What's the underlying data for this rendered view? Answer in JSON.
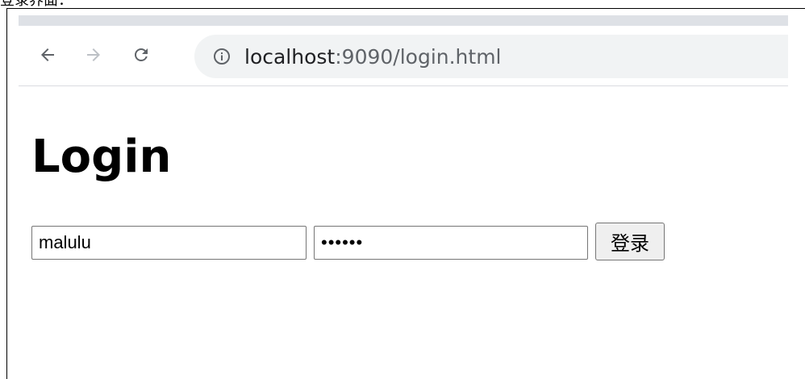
{
  "caption": "登录界面：",
  "browser": {
    "address_bar": {
      "host": "localhost",
      "rest": ":9090/login.html"
    },
    "icons": {
      "back": "arrow-left-icon",
      "forward": "arrow-right-icon",
      "reload": "reload-icon",
      "site_info": "info-icon"
    },
    "colors": {
      "tabstrip": "#dee1e6",
      "omnibox": "#f1f3f4",
      "icon_active": "#5f6368",
      "icon_disabled": "#bdc1c6"
    }
  },
  "page": {
    "title": "Login",
    "username_value": "malulu",
    "password_value": "••••••",
    "submit_label": "登录"
  }
}
